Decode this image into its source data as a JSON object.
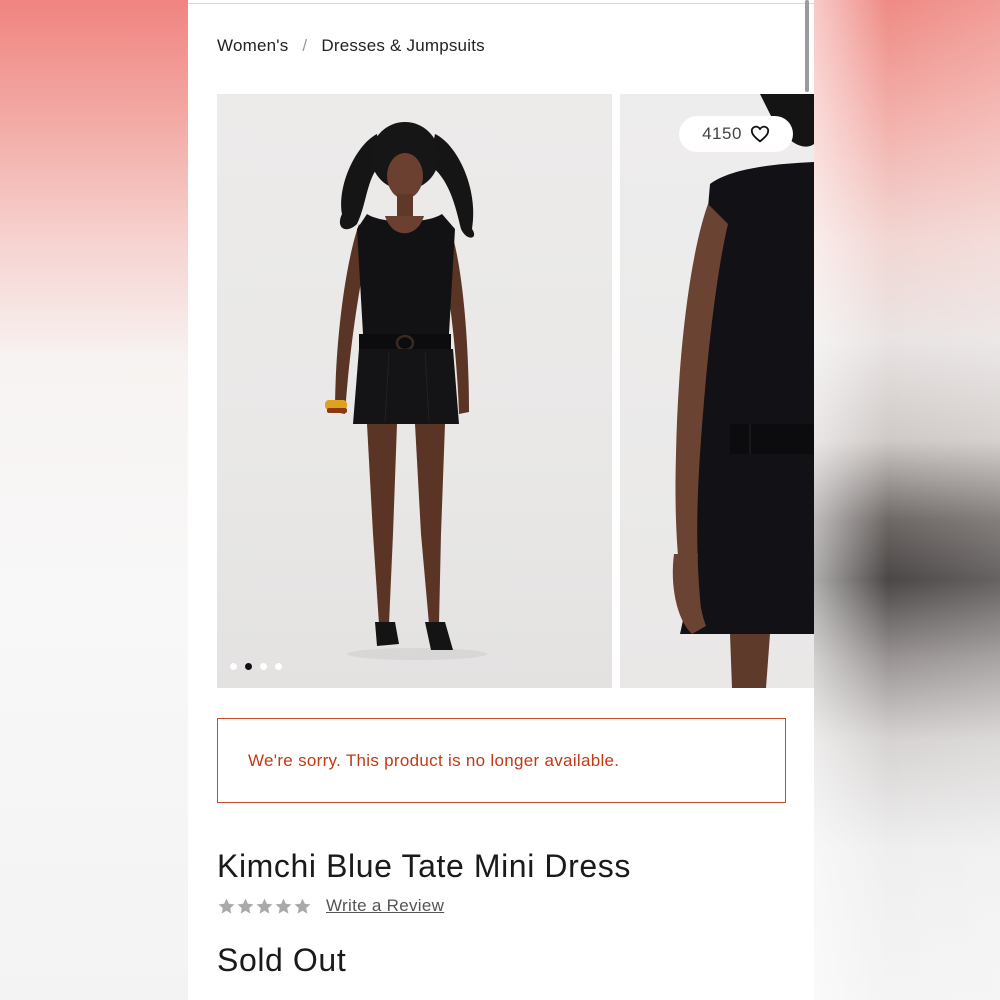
{
  "breadcrumb": {
    "items": [
      "Women's",
      "Dresses & Jumpsuits"
    ],
    "separator": "/"
  },
  "gallery": {
    "likes_count": "4150",
    "like_icon": "heart-outline-icon",
    "dots_total": 4,
    "dots_active_index": 1
  },
  "alert": {
    "message": "We're sorry. This product is no longer available.",
    "color": "#c23a14"
  },
  "product": {
    "title": "Kimchi Blue Tate Mini Dress",
    "rating": 0,
    "rating_max": 5,
    "review_link": "Write a Review",
    "status": "Sold Out"
  }
}
